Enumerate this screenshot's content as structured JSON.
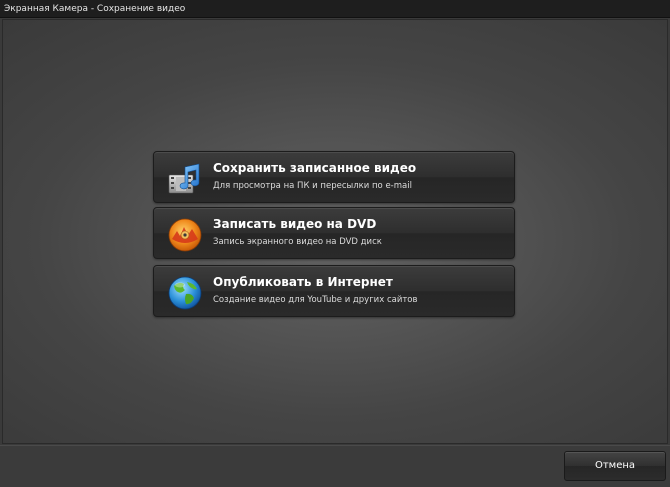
{
  "window": {
    "title": "Экранная Камера - Сохранение видео"
  },
  "options": [
    {
      "title": "Сохранить записанное видео",
      "subtitle": "Для просмотра на ПК и пересылки по e-mail",
      "icon": "film-music-icon"
    },
    {
      "title": "Записать видео на DVD",
      "subtitle": "Запись экранного видео на DVD диск",
      "icon": "dvd-disc-icon"
    },
    {
      "title": "Опубликовать в Интернет",
      "subtitle": "Создание видео для YouTube и других сайтов",
      "icon": "globe-icon"
    }
  ],
  "footer": {
    "cancel_label": "Отмена"
  }
}
